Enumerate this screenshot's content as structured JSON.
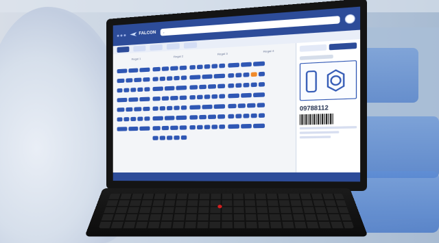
{
  "scene": {
    "subject": "laptop-in-warehouse",
    "colors": {
      "brand_blue": "#2d4c99",
      "bin_blue": "#2f57b4",
      "accent_orange": "#f08a2a",
      "background_blue": "#b9c9db"
    }
  },
  "app": {
    "logo_text": "FALCON",
    "tabs": [
      {
        "label": ""
      },
      {
        "label": ""
      },
      {
        "label": ""
      },
      {
        "label": ""
      },
      {
        "label": ""
      }
    ],
    "aisle_labels": [
      "Regal 1",
      "Regal 2",
      "Regal 3",
      "Regal 4"
    ],
    "detail_panel": {
      "part_number": "09788112"
    }
  }
}
